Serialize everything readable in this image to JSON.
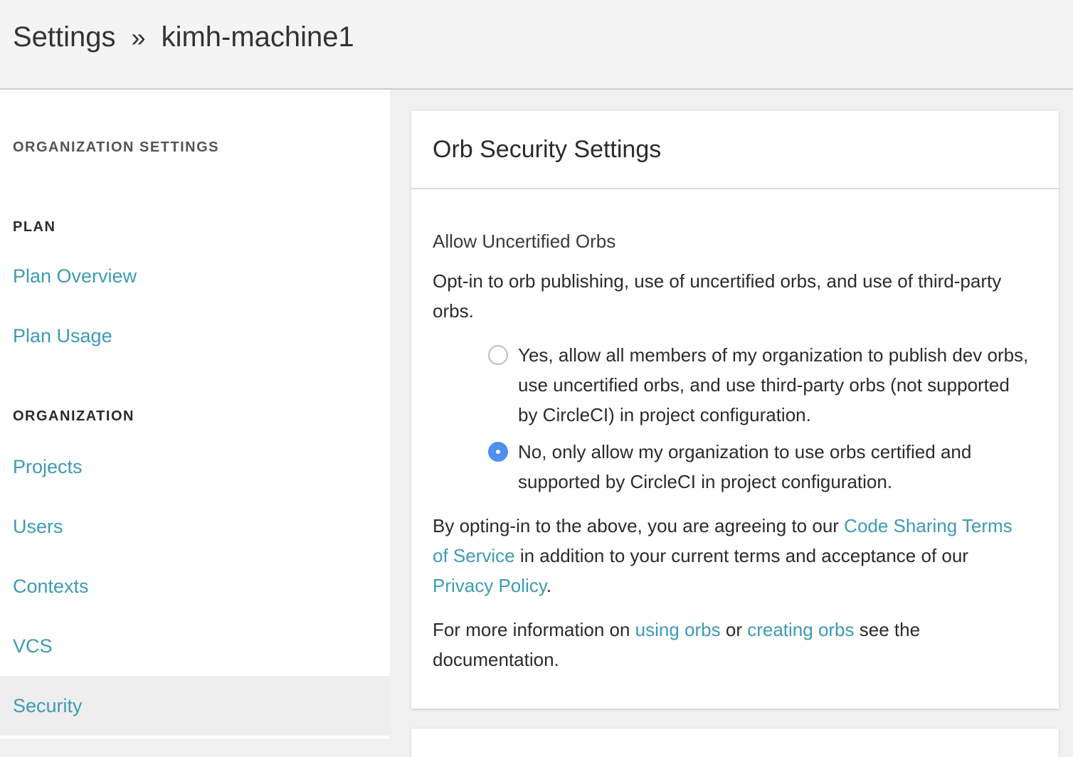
{
  "header": {
    "crumb_root": "Settings",
    "separator": "»",
    "crumb_current": "kimh-machine1"
  },
  "sidebar": {
    "org_settings_heading": "ORGANIZATION SETTINGS",
    "plan_heading": "PLAN",
    "plan_items": [
      "Plan Overview",
      "Plan Usage"
    ],
    "org_heading": "ORGANIZATION",
    "org_items": [
      "Projects",
      "Users",
      "Contexts",
      "VCS",
      "Security"
    ],
    "active_item": "Security"
  },
  "card": {
    "title": "Orb Security Settings",
    "label": "Allow Uncertified Orbs",
    "description": "Opt-in to orb publishing, use of uncertified orbs, and use of third-party orbs.",
    "options": [
      {
        "label": "Yes, allow all members of my organization to publish dev orbs, use uncertified orbs, and use third-party orbs (not supported by CircleCI) in project configuration.",
        "checked": false
      },
      {
        "label": "No, only allow my organization to use orbs certified and supported by CircleCI in project configuration.",
        "checked": true
      }
    ],
    "terms": {
      "pre": "By opting-in to the above, you are agreeing to our ",
      "link1": "Code Sharing Terms of Service",
      "mid": " in addition to your current terms and acceptance of our ",
      "link2": "Privacy Policy",
      "post": "."
    },
    "info": {
      "pre": "For more information on ",
      "link1": "using orbs",
      "mid": " or ",
      "link2": "creating orbs",
      "post": " see the documentation."
    }
  },
  "colors": {
    "link": "#3e9ab5",
    "radio_checked": "#4f8ff0",
    "active_bg": "#eeeeee"
  }
}
